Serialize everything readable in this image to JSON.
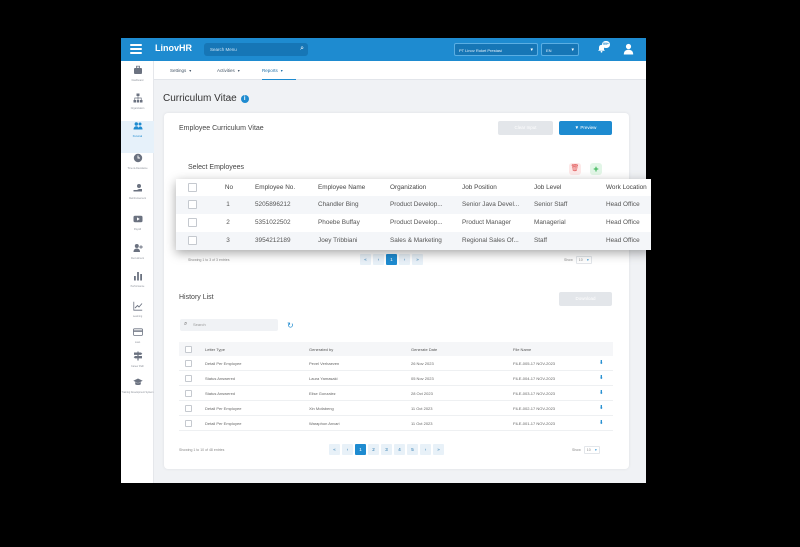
{
  "app": {
    "brand": "LinovHR",
    "search_placeholder": "Search Menu",
    "company_select": "PT Linov Roket Prestasi",
    "lang_select": "EN",
    "notif_count": "99+"
  },
  "subnav": {
    "tabs": [
      {
        "label": "Settings"
      },
      {
        "label": "Activities"
      },
      {
        "label": "Reports"
      }
    ]
  },
  "sidebar": {
    "items": [
      {
        "label": "Dashboard",
        "icon": "briefcase-icon"
      },
      {
        "label": "Organization",
        "icon": "org-chart-icon"
      },
      {
        "label": "Personal",
        "icon": "people-icon"
      },
      {
        "label": "Time & Attendance",
        "icon": "clock-icon"
      },
      {
        "label": "Reimbursement",
        "icon": "hand-money-icon"
      },
      {
        "label": "Payroll",
        "icon": "video-icon"
      },
      {
        "label": "Recruitment",
        "icon": "add-user-icon"
      },
      {
        "label": "Performance",
        "icon": "bar-chart-icon"
      },
      {
        "label": "Learning",
        "icon": "line-chart-icon"
      },
      {
        "label": "Loan",
        "icon": "card-icon"
      },
      {
        "label": "Career Path",
        "icon": "signpost-icon"
      },
      {
        "label": "Training Development System",
        "icon": "graduation-icon"
      }
    ]
  },
  "page": {
    "title": "Curriculum Vitae",
    "card_title": "Employee Curriculum Vitae",
    "clear_button": "Clear Input",
    "preview_button": "Preview",
    "select_title": "Select Employees",
    "select_showing": "Showing 1 to 3 of 3 entries",
    "show_label": "Show",
    "show_value": "10",
    "select_pager": [
      "«",
      "‹",
      "1",
      "›",
      "»"
    ],
    "history_title": "History List",
    "download_button": "Download",
    "history_search_placeholder": "Search",
    "history_showing": "Showing 1 to 10 of 48 entries",
    "history_pager": [
      "«",
      "‹",
      "1",
      "2",
      "3",
      "4",
      "5",
      "›",
      "»"
    ]
  },
  "employees": {
    "columns": [
      "No",
      "Employee No.",
      "Employee Name",
      "Organization",
      "Job Position",
      "Job Level",
      "Work Location"
    ],
    "rows": [
      [
        "1",
        "5205896212",
        "Chandler Bing",
        "Product Develop...",
        "Senior Java Devel...",
        "Senior Staff",
        "Head Office"
      ],
      [
        "2",
        "5351022502",
        "Phoebe Buffay",
        "Product Develop...",
        "Product Manager",
        "Managerial",
        "Head Office"
      ],
      [
        "3",
        "3954212189",
        "Joey Tribbiani",
        "Sales & Marketing",
        "Regional Sales Of...",
        "Staff",
        "Head Office"
      ]
    ]
  },
  "history": {
    "columns": [
      "Letter Type",
      "Generated by",
      "Generate Date",
      "File Name"
    ],
    "rows": [
      [
        "Detail Per Employee",
        "Pevel Verhaeven",
        "26 Nov 2023",
        "FILE-005-17 NOV-2023"
      ],
      [
        "Status Answered",
        "Laura Yamasaki",
        "05 Nov 2023",
        "FILE-004-17 NOV-2023"
      ],
      [
        "Status Answered",
        "Elise Gonzalez",
        "28 Oct 2023",
        "FILE-003-17 NOV-2023"
      ],
      [
        "Detail Per Employee",
        "Xin Mofabeng",
        "11 Oct 2023",
        "FILE-002-17 NOV-2023"
      ],
      [
        "Detail Per Employee",
        "Waraphon Anvari",
        "11 Oct 2023",
        "FILE-001-17 NOV-2023"
      ]
    ]
  },
  "colors": {
    "primary": "#1e8bd0",
    "danger": "#e05252",
    "success": "#2bb04a"
  }
}
